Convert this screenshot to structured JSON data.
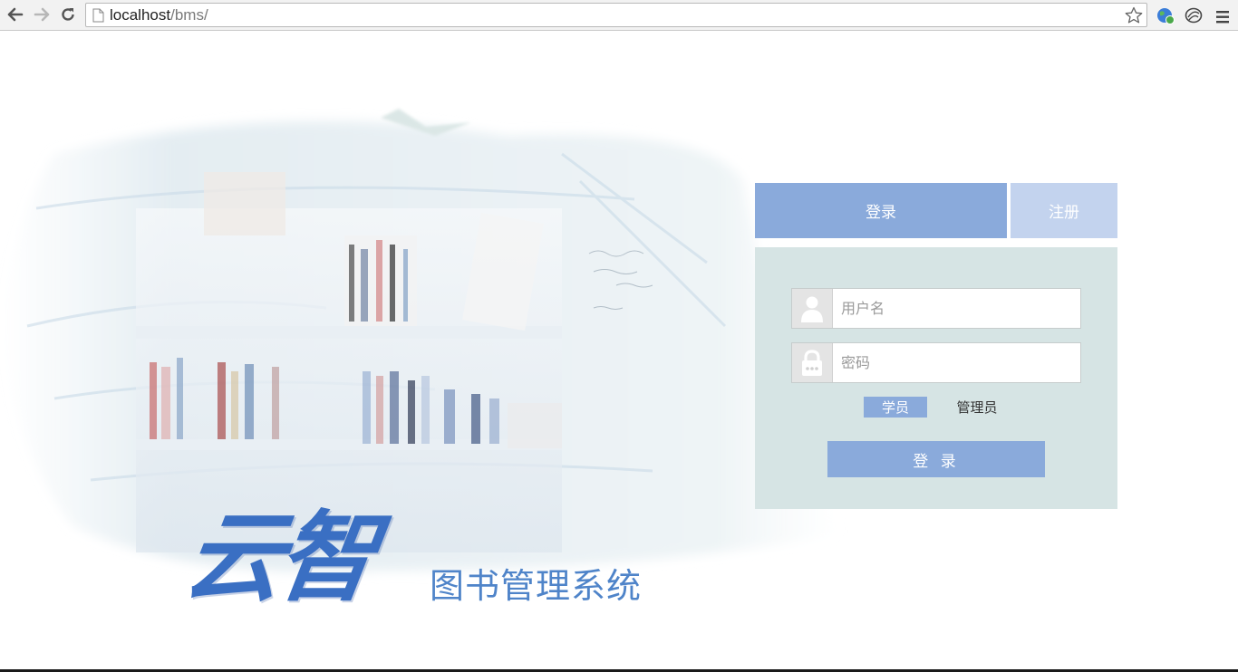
{
  "browser": {
    "url_host": "localhost",
    "url_path": "/bms/",
    "icons": {
      "back": "arrow-left-icon",
      "forward": "arrow-right-icon",
      "reload": "reload-icon",
      "page": "page-icon",
      "bookmark": "star-icon",
      "extension_1": "globe-icon",
      "extension_2": "extension-icon",
      "menu": "menu-icon"
    }
  },
  "hero": {
    "brand_big": "云智",
    "brand_sub": "图书管理系统",
    "accent_color": "#3a6fc3"
  },
  "tabs": {
    "login": "登录",
    "register": "注册",
    "active_color": "#8aaadb",
    "inactive_color": "#c3d3ee"
  },
  "form": {
    "username_placeholder": "用户名",
    "username_value": "",
    "password_placeholder": "密码",
    "password_value": "",
    "username_icon": "user-icon",
    "password_icon": "lock-icon",
    "roles": [
      "学员",
      "管理员"
    ],
    "selected_role": "学员",
    "submit_label": "登 录",
    "panel_color": "#d6e4e4"
  }
}
